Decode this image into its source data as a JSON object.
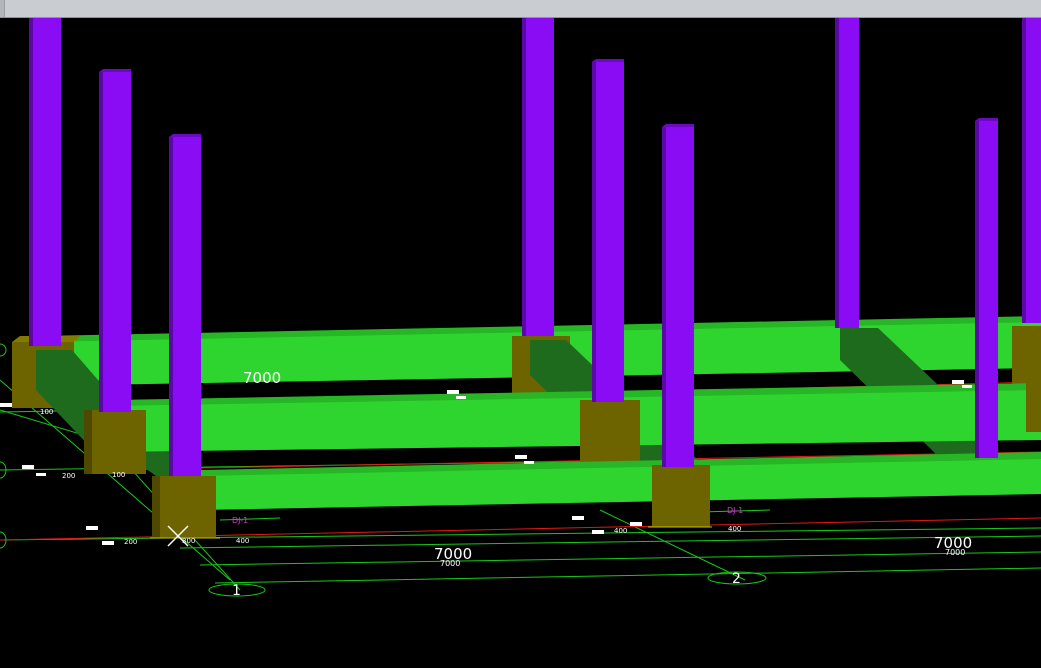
{
  "window": {
    "titlebar_label": ""
  },
  "viewport": {
    "background": "#000000",
    "colors": {
      "beam": "#2ed52e",
      "beam_side": "#1e6b1e",
      "column": "#8a0cf5",
      "column_shade": "#5b09a6",
      "footing": "#6d6400",
      "footing_shade": "#4f4800",
      "grid_green": "#18c818",
      "grid_red": "#e01818",
      "text_white": "#ffffff",
      "text_magenta": "#d236d2"
    },
    "dimensions": {
      "top_left": "7000",
      "bottom_middle": "7000",
      "bottom_middle_small": "7000",
      "bottom_right": "7000",
      "bottom_right_small": "7000"
    },
    "small_dims": {
      "d100_a": "100",
      "d100_b": "100",
      "d200_a": "200",
      "d200_b": "200",
      "d300": "300",
      "d400_a": "400",
      "d400_b": "400",
      "d400_c": "400"
    },
    "axis_labels": {
      "axis_1": "1",
      "axis_2": "2"
    },
    "footing_tags": {
      "tag_1": "DJ-1",
      "tag_2": "DJ-1"
    },
    "cursor": "crosshair-cursor"
  }
}
